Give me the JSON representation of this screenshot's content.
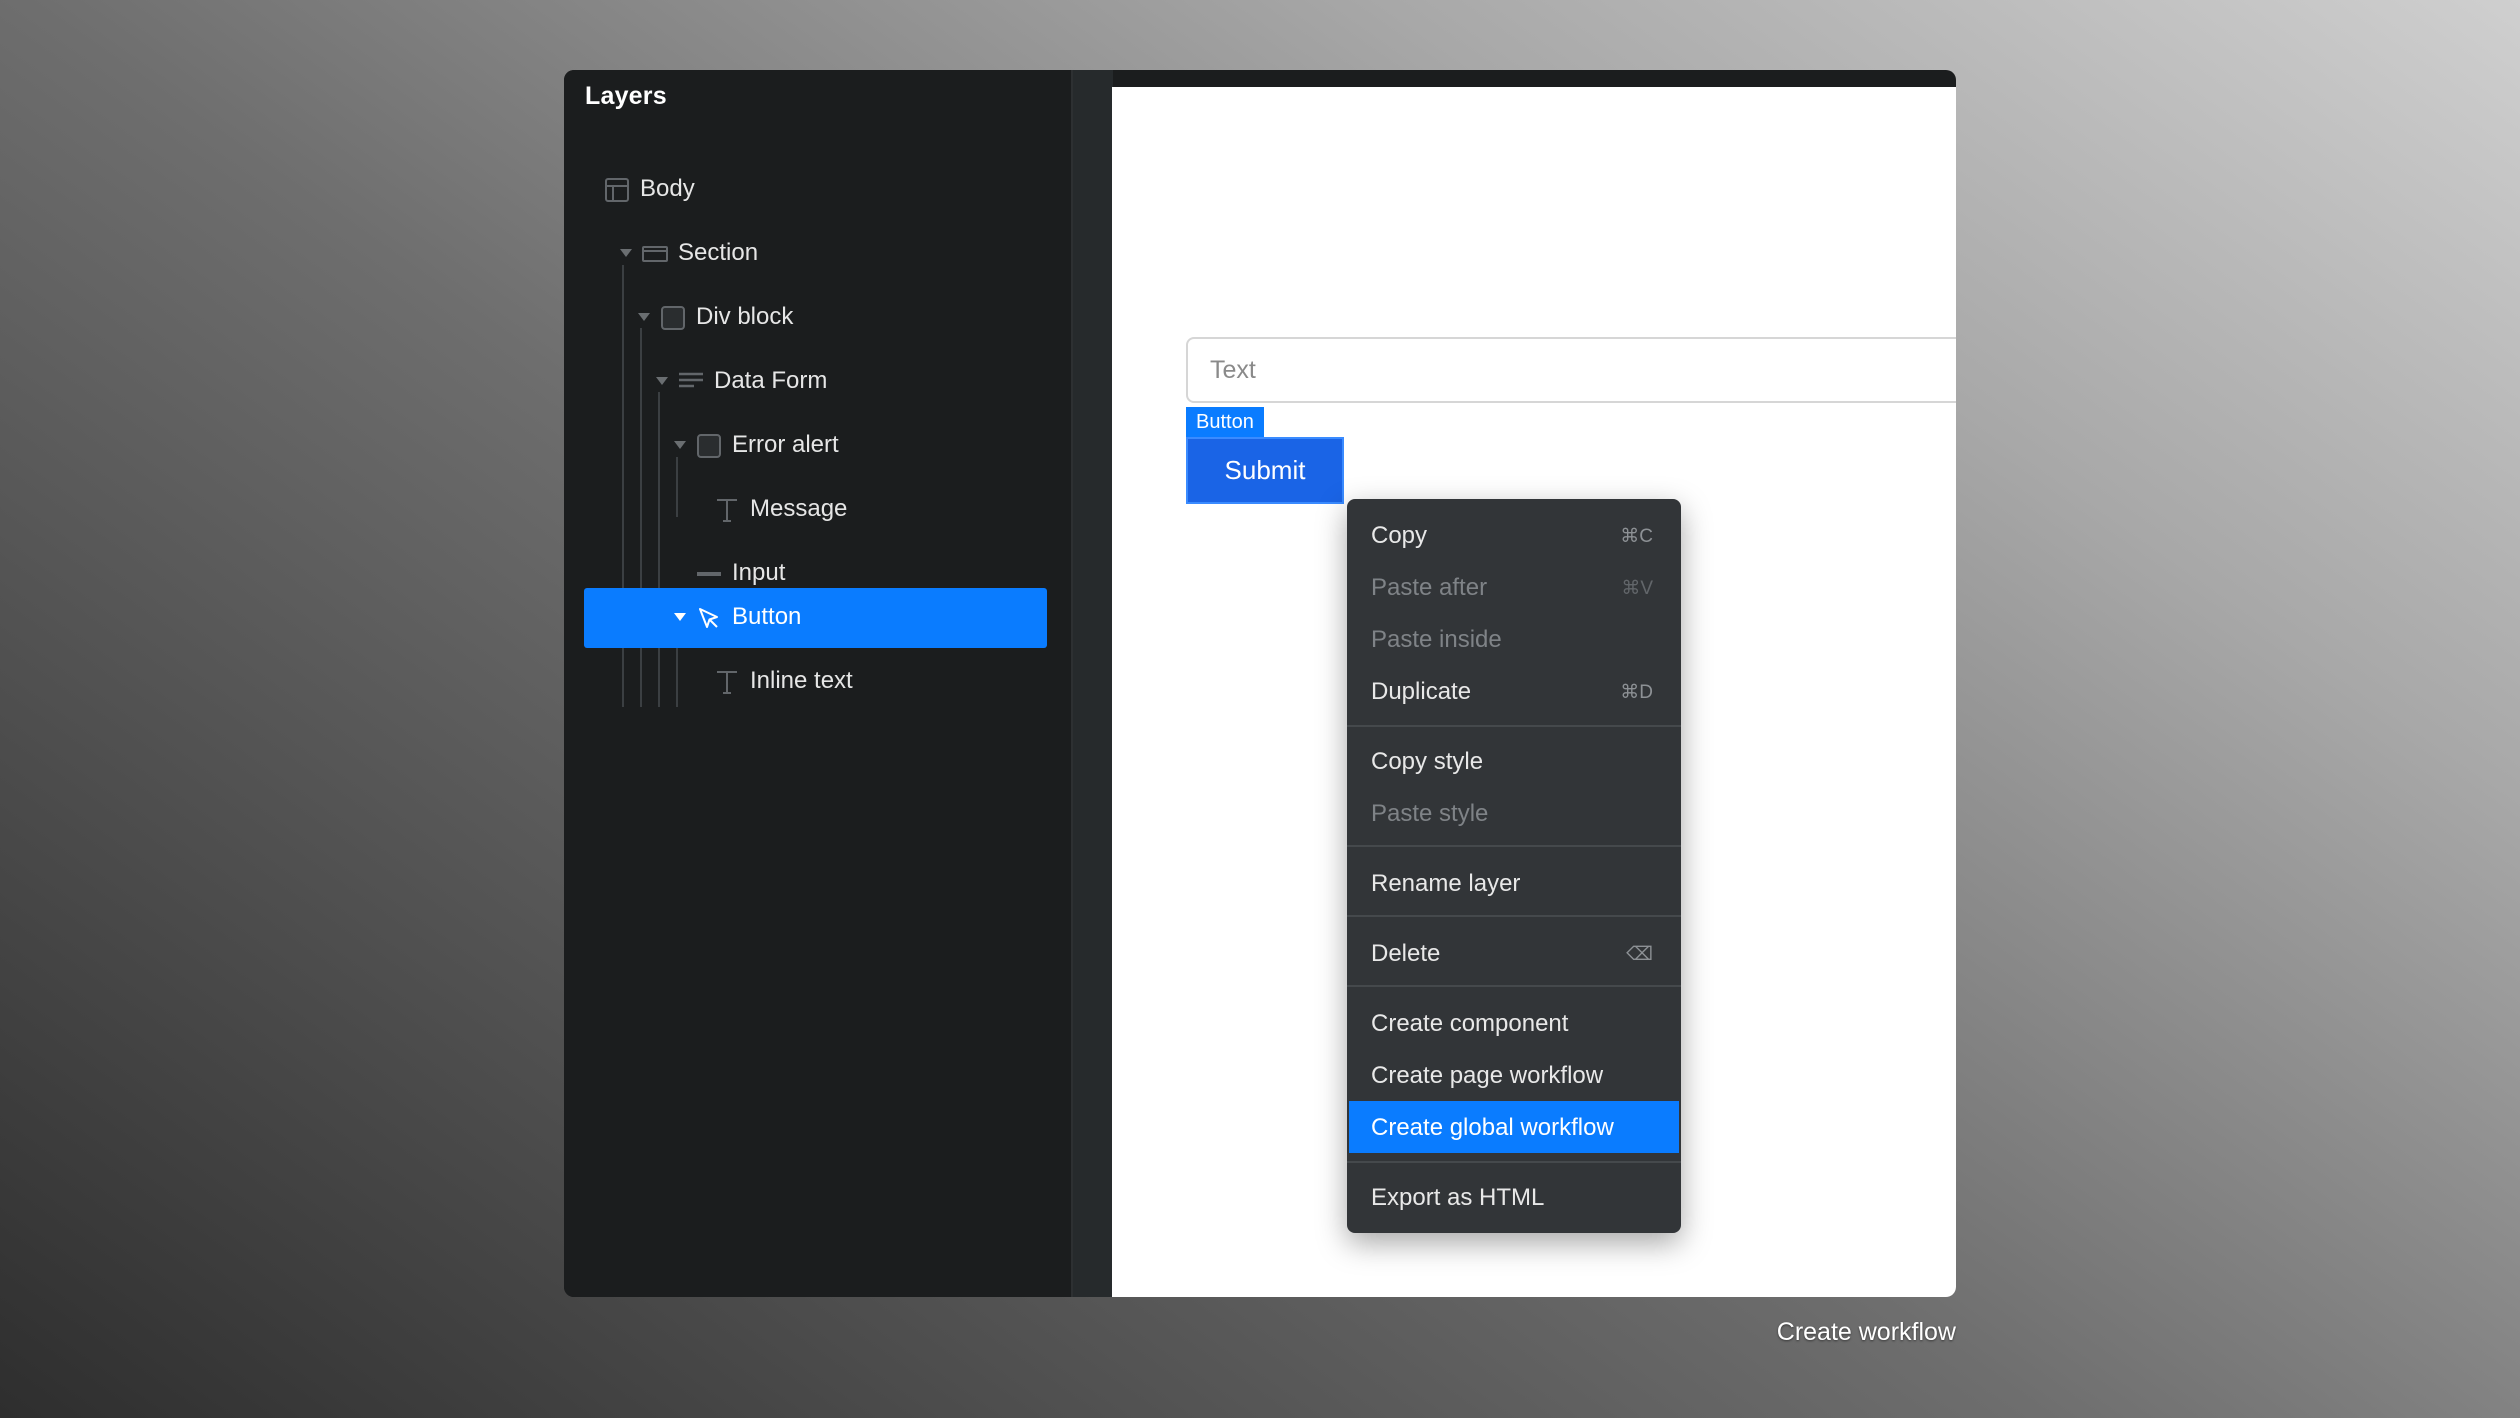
{
  "layers_panel": {
    "title": "Layers",
    "items": [
      {
        "label": "Body"
      },
      {
        "label": "Section"
      },
      {
        "label": "Div block"
      },
      {
        "label": "Data Form"
      },
      {
        "label": "Error alert"
      },
      {
        "label": "Message"
      },
      {
        "label": "Input"
      },
      {
        "label": "Button",
        "selected": true
      },
      {
        "label": "Inline text"
      }
    ]
  },
  "canvas": {
    "input_placeholder": "Text",
    "selection_tag": "Button",
    "submit_label": "Submit"
  },
  "context_menu": {
    "items": [
      {
        "label": "Copy",
        "shortcut": "⌘C"
      },
      {
        "label": "Paste after",
        "shortcut": "⌘V",
        "disabled": true
      },
      {
        "label": "Paste inside",
        "disabled": true
      },
      {
        "label": "Duplicate",
        "shortcut": "⌘D"
      },
      {
        "label": "Copy style"
      },
      {
        "label": "Paste style",
        "disabled": true
      },
      {
        "label": "Rename layer"
      },
      {
        "label": "Delete",
        "shortcut": "⌫"
      },
      {
        "label": "Create component"
      },
      {
        "label": "Create page workflow"
      },
      {
        "label": "Create global workflow",
        "active": true
      },
      {
        "label": "Export as HTML"
      }
    ]
  },
  "caption": "Create workflow",
  "colors": {
    "accent": "#0a7cff",
    "panel": "#1b1d1e",
    "menu": "#323538",
    "submit": "#1a64e6"
  }
}
